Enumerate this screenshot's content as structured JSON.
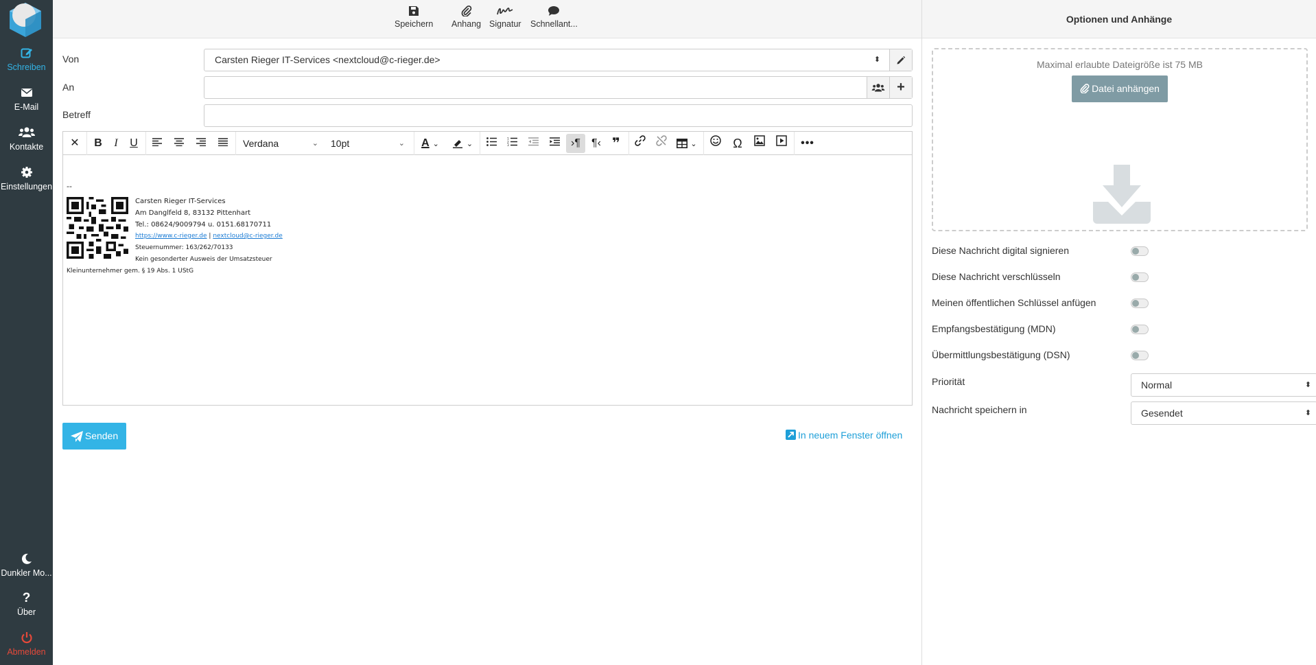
{
  "sidebar": {
    "items": [
      {
        "label": "Schreiben",
        "icon": "pen-square-icon",
        "active": true
      },
      {
        "label": "E-Mail",
        "icon": "envelope-icon"
      },
      {
        "label": "Kontakte",
        "icon": "users-icon"
      },
      {
        "label": "Einstellungen",
        "icon": "gear-icon"
      }
    ],
    "bottom": [
      {
        "label": "Dunkler Mo...",
        "icon": "moon-icon"
      },
      {
        "label": "Über",
        "icon": "question-icon"
      },
      {
        "label": "Abmelden",
        "icon": "power-icon"
      }
    ]
  },
  "toolbar": {
    "save_label": "Speichern",
    "attach_label": "Anhang",
    "signature_label": "Signatur",
    "quick_reply_label": "Schnellant..."
  },
  "form": {
    "from_label": "Von",
    "from_value": "Carsten Rieger IT-Services <nextcloud@c-rieger.de>",
    "to_label": "An",
    "to_value": "",
    "subject_label": "Betreff",
    "subject_value": ""
  },
  "editor": {
    "font_family": "Verdana",
    "font_size": "10pt",
    "signature": {
      "dash": "--",
      "name": "Carsten Rieger IT-Services",
      "address": "Am Danglfeld 8, 83132 Pittenhart",
      "phone": "Tel.: 08624/9009794 u. 0151.68170711",
      "website": "https://www.c-rieger.de",
      "separator": " | ",
      "email": "nextcloud@c-rieger.de",
      "tax_number": "Steuernummer: 163/262/70133",
      "vat_note_1": "Kein gesonderter Ausweis der Umsatzsteuer",
      "vat_note_2": "Kleinunternehmer gem. § 19 Abs. 1 UStG"
    }
  },
  "actions": {
    "send_label": "Senden",
    "new_window_label": "In neuem Fenster öffnen"
  },
  "options": {
    "title": "Optionen und Anhänge",
    "max_size_text": "Maximal erlaubte Dateigröße ist 75 MB",
    "attach_button": "Datei anhängen",
    "sign_label": "Diese Nachricht digital signieren",
    "encrypt_label": "Diese Nachricht verschlüsseln",
    "pubkey_label": "Meinen öffentlichen Schlüssel anfügen",
    "mdn_label": "Empfangsbestätigung (MDN)",
    "dsn_label": "Übermittlungsbestätigung (DSN)",
    "priority_label": "Priorität",
    "priority_value": "Normal",
    "save_in_label": "Nachricht speichern in",
    "save_in_value": "Gesendet"
  },
  "colors": {
    "sidebar_bg": "#2f3b41",
    "accent": "#33b4e6",
    "danger": "#e5493a",
    "attach_button_bg": "#7f9ba4"
  }
}
